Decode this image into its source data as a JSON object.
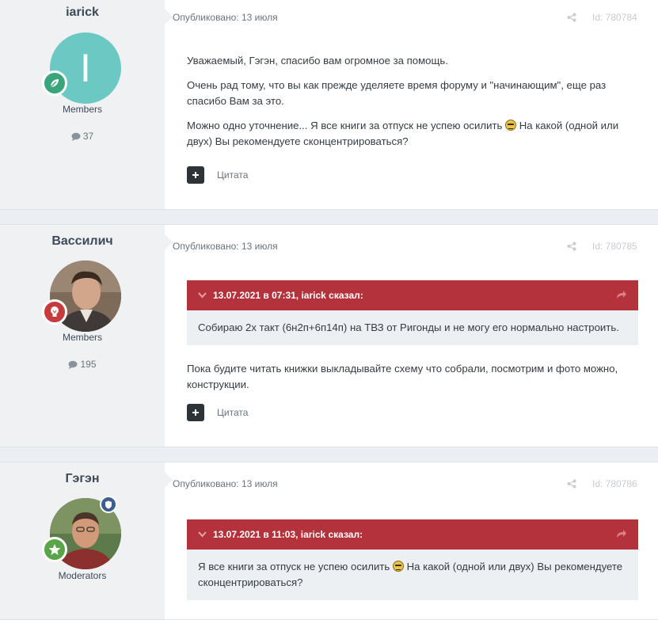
{
  "posts": [
    {
      "author": "iarick",
      "avatar_letter": "I",
      "group": "Members",
      "count": "37",
      "published": "Опубликовано: 13 июля",
      "post_id": "Id: 780784",
      "paragraphs": [
        "Уважаемый, Гэгэн, спасибо вам огромное за помощь.",
        "Очень рад тому, что вы как прежде уделяете время форуму и \"начинающим\", еще раз спасибо Вам за это.",
        "Можно одно уточнение... Я все книги за отпуск не успею осилить",
        "На какой (одной или двух) Вы рекомендуете сконцентрироваться?"
      ],
      "quote_label": "Цитата",
      "badge_color": "#3aa57a"
    },
    {
      "author": "Вассилич",
      "group": "Members",
      "count": "195",
      "published": "Опубликовано: 13 июля",
      "post_id": "Id: 780785",
      "quote_header": "13.07.2021 в 07:31, iarick сказал:",
      "quote_text": "Собираю 2х такт (6н2п+6п14п) на ТВЗ от Ригонды и не могу его нормально настроить.",
      "paragraphs": [
        "Пока будите читать книжки выкладывайте схему что собрали, посмотрим и фото можно, конструкции."
      ],
      "quote_label": "Цитата",
      "badge_color": "#c63b3b"
    },
    {
      "author": "Гэгэн",
      "group": "Moderators",
      "published": "Опубликовано: 13 июля",
      "post_id": "Id: 780786",
      "quote_header": "13.07.2021 в 11:03, iarick сказал:",
      "quote_text_a": "Я все книги за отпуск не успею осилить",
      "quote_text_b": "На какой (одной или двух) Вы рекомендуете сконцентрироваться?",
      "badge_color": "#5aa547"
    }
  ]
}
